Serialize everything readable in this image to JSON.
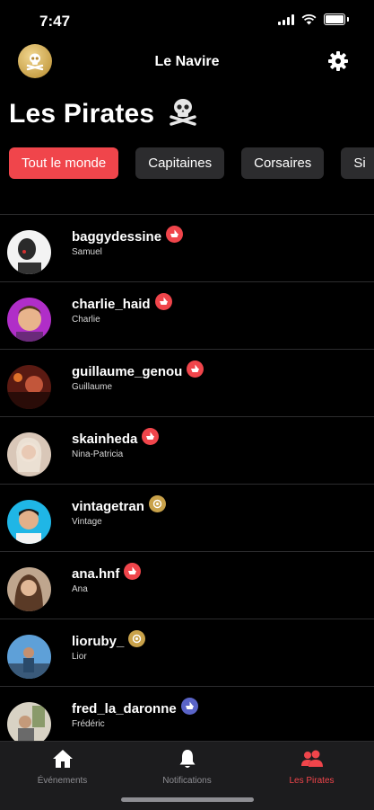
{
  "status": {
    "time": "7:47"
  },
  "nav": {
    "title": "Le Navire"
  },
  "page": {
    "title": "Les Pirates"
  },
  "filters": [
    {
      "label": "Tout le monde",
      "active": true
    },
    {
      "label": "Capitaines",
      "active": false
    },
    {
      "label": "Corsaires",
      "active": false
    },
    {
      "label": "Si",
      "active": false
    }
  ],
  "members": [
    {
      "handle": "baggydessine",
      "name": "Samuel",
      "badge": "red-ship"
    },
    {
      "handle": "charlie_haid",
      "name": "Charlie",
      "badge": "red-ship"
    },
    {
      "handle": "guillaume_genou",
      "name": "Guillaume",
      "badge": "red-ship"
    },
    {
      "handle": "skainheda",
      "name": "Nina-Patricia",
      "badge": "red-ship"
    },
    {
      "handle": "vintagetran",
      "name": "Vintage",
      "badge": "gold-medal"
    },
    {
      "handle": "ana.hnf",
      "name": "Ana",
      "badge": "red-ship"
    },
    {
      "handle": "lioruby_",
      "name": "Lior",
      "badge": "gold-medal"
    },
    {
      "handle": "fred_la_daronne",
      "name": "Frédéric",
      "badge": "blue-ship"
    }
  ],
  "tabs": [
    {
      "label": "Événements",
      "icon": "home-icon",
      "active": false
    },
    {
      "label": "Notifications",
      "icon": "bell-icon",
      "active": false
    },
    {
      "label": "Les Pirates",
      "icon": "people-icon",
      "active": true
    }
  ],
  "colors": {
    "accent": "#f0454b",
    "chip": "#2c2c2e",
    "background": "#000000",
    "gold": "#c9a24a",
    "blue": "#5a64c8"
  }
}
